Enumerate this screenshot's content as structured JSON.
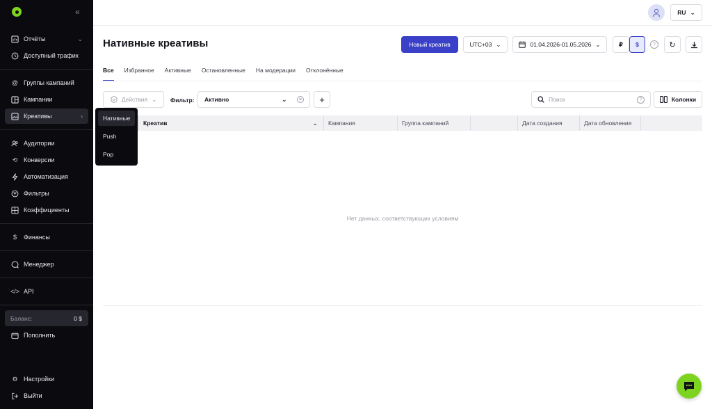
{
  "sidebar": {
    "groups": [
      [
        {
          "label": "Отчёты",
          "icon": "chart-icon",
          "chevron": "down"
        },
        {
          "label": "Доступный трафик",
          "icon": "clock-icon"
        }
      ],
      [
        {
          "label": "Группы кампаний",
          "icon": "at-icon"
        },
        {
          "label": "Кампании",
          "icon": "grid-icon"
        },
        {
          "label": "Креативы",
          "icon": "image-icon",
          "active": true,
          "chevron": "right"
        }
      ],
      [
        {
          "label": "Аудитории",
          "icon": "users-icon"
        },
        {
          "label": "Конверсии",
          "icon": "refresh-icon"
        },
        {
          "label": "Автоматизация",
          "icon": "bolt-icon"
        },
        {
          "label": "Фильтры",
          "icon": "filter-icon"
        },
        {
          "label": "Коэффициенты",
          "icon": "table-icon"
        }
      ],
      [
        {
          "label": "Финансы",
          "icon": "dollar-icon"
        }
      ],
      [
        {
          "label": "Менеджер",
          "icon": "chat-icon"
        }
      ],
      [
        {
          "label": "API",
          "icon": "code-icon"
        }
      ]
    ],
    "balance_label": "Баланс:",
    "balance_value": "0 $",
    "topup": "Пополнить",
    "settings": "Настройки",
    "logout": "Выйти"
  },
  "flyout": [
    "Нативные",
    "Push",
    "Pop"
  ],
  "topbar": {
    "lang": "RU"
  },
  "header": {
    "title": "Нативные креативы",
    "new_button": "Новый креатив",
    "timezone": "UTC+03",
    "date_range": "01.04.2026-01.05.2026",
    "currency_rub": "₽",
    "currency_usd": "$"
  },
  "tabs": [
    "Все",
    "Избранное",
    "Активные",
    "Остановленные",
    "На модерации",
    "Отклонённые"
  ],
  "filters": {
    "actions": "Действия",
    "filter_label": "Фильтр:",
    "filter_value": "Активно",
    "search_placeholder": "Поиск",
    "columns_button": "Колонки"
  },
  "table": {
    "columns": [
      "Креатив",
      "Кампания",
      "Группа кампаний",
      "",
      "Дата создания",
      "Дата обновления"
    ],
    "empty": "Нет данных, соответствующих условиям"
  },
  "colors": {
    "accent": "#3a40c8",
    "brand_green": "#7ed321",
    "sidebar_bg": "#0b0b0f"
  }
}
